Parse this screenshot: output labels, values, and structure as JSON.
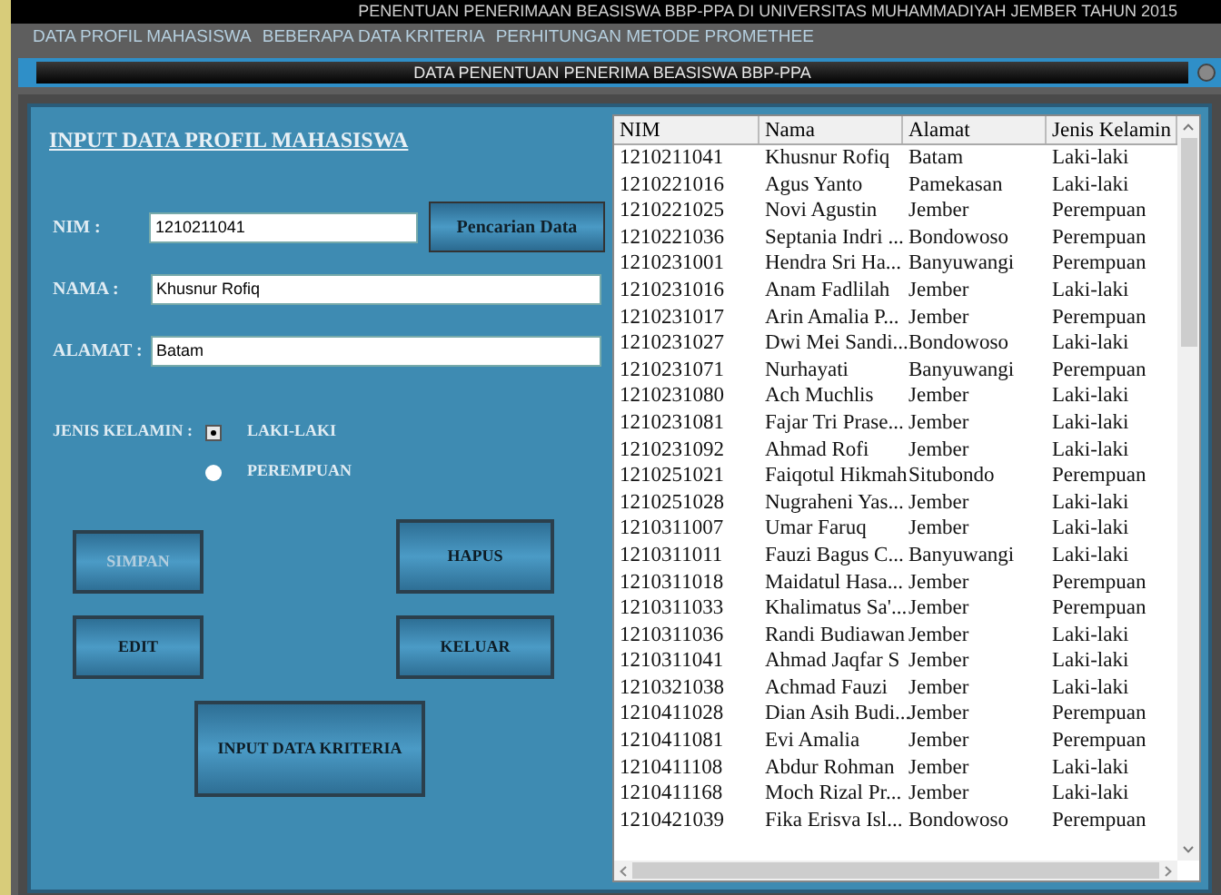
{
  "app_title": "PENENTUAN PENERIMAAN BEASISWA BBP-PPA DI UNIVERSITAS MUHAMMADIYAH JEMBER TAHUN 2015",
  "menu": [
    "DATA PROFIL MAHASISWA",
    "BEBERAPA DATA KRITERIA",
    "PERHITUNGAN METODE PROMETHEE"
  ],
  "window": {
    "title": "DATA PENENTUAN PENERIMA BEASISWA BBP-PPA"
  },
  "form": {
    "heading": "INPUT DATA PROFIL MAHASISWA",
    "fields": [
      {
        "label": "NIM :",
        "value": "1210211041"
      },
      {
        "label": "NAMA :",
        "value": "Khusnur Rofiq"
      },
      {
        "label": "ALAMAT :",
        "value": "Batam"
      }
    ],
    "search_button": "Pencarian Data",
    "gender_label": "JENIS KELAMIN :",
    "gender_options": [
      {
        "label": "LAKI-LAKI",
        "selected": true
      },
      {
        "label": "PEREMPUAN",
        "selected": false
      }
    ],
    "buttons": [
      {
        "label": "SIMPAN",
        "disabled": true
      },
      {
        "label": "HAPUS",
        "disabled": false
      },
      {
        "label": "EDIT",
        "disabled": false
      },
      {
        "label": "KELUAR",
        "disabled": false
      },
      {
        "label": "INPUT DATA KRITERIA",
        "disabled": false
      }
    ]
  },
  "table": {
    "columns": [
      "NIM",
      "Nama",
      "Alamat",
      "Jenis Kelamin"
    ],
    "rows": [
      [
        "1210211041",
        "Khusnur Rofiq",
        "Batam",
        "Laki-laki"
      ],
      [
        "1210221016",
        "Agus Yanto",
        "Pamekasan",
        "Laki-laki"
      ],
      [
        "1210221025",
        "Novi Agustin",
        "Jember",
        "Perempuan"
      ],
      [
        "1210221036",
        "Septania Indri ...",
        "Bondowoso",
        "Perempuan"
      ],
      [
        "1210231001",
        "Hendra Sri Ha...",
        "Banyuwangi",
        "Perempuan"
      ],
      [
        "1210231016",
        "Anam Fadlilah",
        "Jember",
        "Laki-laki"
      ],
      [
        "1210231017",
        "Arin Amalia P...",
        "Jember",
        "Perempuan"
      ],
      [
        "1210231027",
        "Dwi Mei Sandi...",
        "Bondowoso",
        "Laki-laki"
      ],
      [
        "1210231071",
        "Nurhayati",
        "Banyuwangi",
        "Perempuan"
      ],
      [
        "1210231080",
        "Ach Muchlis",
        "Jember",
        "Laki-laki"
      ],
      [
        "1210231081",
        "Fajar Tri Prase...",
        "Jember",
        "Laki-laki"
      ],
      [
        "1210231092",
        "Ahmad Rofi",
        "Jember",
        "Laki-laki"
      ],
      [
        "1210251021",
        "Faiqotul Hikmah",
        "Situbondo",
        "Perempuan"
      ],
      [
        "1210251028",
        "Nugraheni Yas...",
        "Jember",
        "Laki-laki"
      ],
      [
        "1210311007",
        "Umar Faruq",
        "Jember",
        "Laki-laki"
      ],
      [
        "1210311011",
        "Fauzi Bagus C...",
        "Banyuwangi",
        "Laki-laki"
      ],
      [
        "1210311018",
        "Maidatul Hasa...",
        "Jember",
        "Perempuan"
      ],
      [
        "1210311033",
        "Khalimatus Sa'...",
        "Jember",
        "Perempuan"
      ],
      [
        "1210311036",
        "Randi Budiawan",
        "Jember",
        "Laki-laki"
      ],
      [
        "1210311041",
        "Ahmad Jaqfar S",
        "Jember",
        "Laki-laki"
      ],
      [
        "1210321038",
        "Achmad Fauzi",
        "Jember",
        "Laki-laki"
      ],
      [
        "1210411028",
        "Dian Asih Budi...",
        "Jember",
        "Perempuan"
      ],
      [
        "1210411081",
        "Evi Amalia",
        "Jember",
        "Perempuan"
      ],
      [
        "1210411108",
        "Abdur Rohman",
        "Jember",
        "Laki-laki"
      ],
      [
        "1210411168",
        "Moch Rizal Pr...",
        "Jember",
        "Laki-laki"
      ],
      [
        "1210421039",
        "Fika Erisva Isl...",
        "Bondowoso",
        "Perempuan"
      ]
    ]
  }
}
